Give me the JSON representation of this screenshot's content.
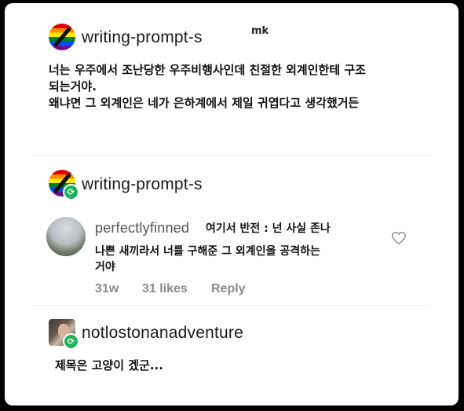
{
  "watermark": "mk",
  "post": {
    "blog_name": "writing-prompt-s",
    "body_line1": "너는 우주에서 조난당한 우주비행사인데 친절한 외계인한테 구조",
    "body_line2": "되는거야.",
    "body_line3": "왜냐면 그 외계인은 네가 은하계에서 제일 귀엽다고 생각했거든"
  },
  "reblog1": {
    "blog_name": "writing-prompt-s",
    "badge_icon": "reblog-icon"
  },
  "comment": {
    "username": "perfectlyfinned",
    "text_line1": "여기서 반전 : 넌 사실 존나",
    "text_line2": "나쁜 새끼라서 너를 구해준 그 외계인을 공격하는",
    "text_line3": "거야",
    "age": "31w",
    "likes": "31 likes",
    "reply_label": "Reply",
    "heart_icon": "heart-outline-icon"
  },
  "reblog2": {
    "blog_name": "notlostonanadventure",
    "text": "제목은 고양이 겠군..."
  },
  "colors": {
    "card_bg": "#ffffff",
    "page_bg": "#000000",
    "reblog_badge": "#1fb35a",
    "meta_gray": "#8a8a8a"
  }
}
